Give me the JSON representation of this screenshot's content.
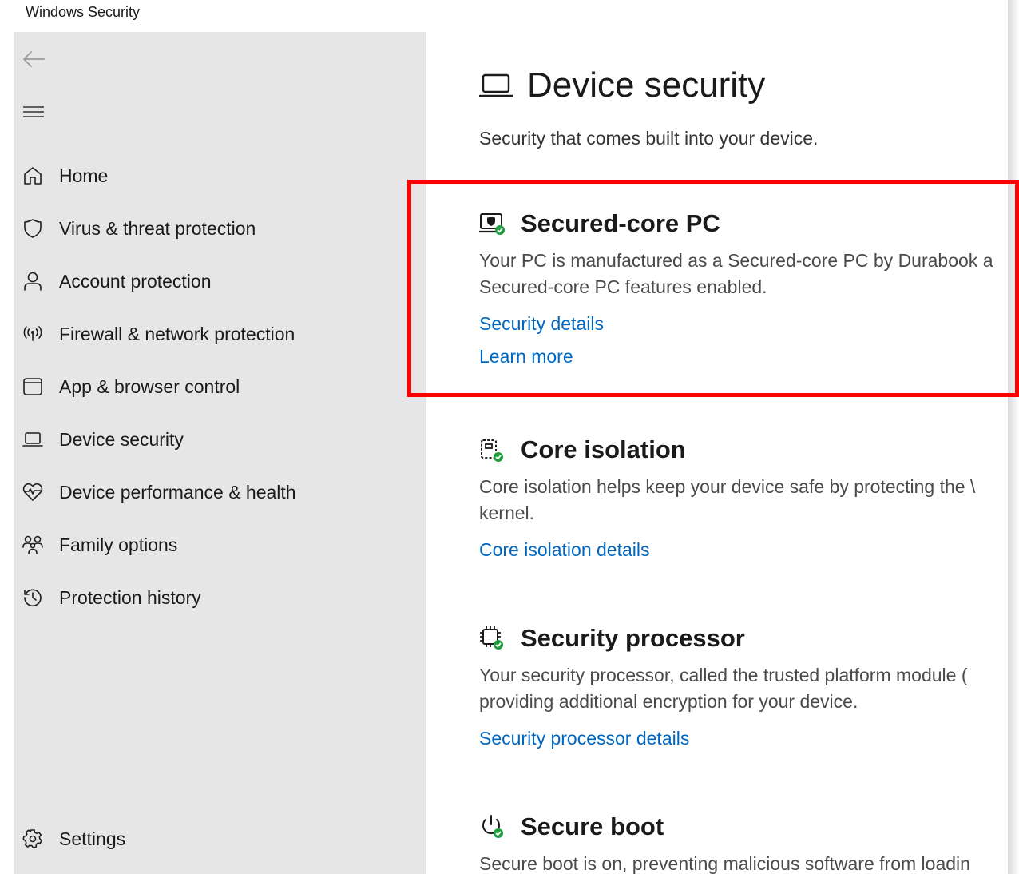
{
  "window": {
    "title": "Windows Security"
  },
  "sidebar": {
    "items": [
      {
        "label": "Home",
        "icon": "home-icon"
      },
      {
        "label": "Virus & threat protection",
        "icon": "shield-icon"
      },
      {
        "label": "Account protection",
        "icon": "person-icon"
      },
      {
        "label": "Firewall & network protection",
        "icon": "wireless-icon"
      },
      {
        "label": "App & browser control",
        "icon": "browser-icon"
      },
      {
        "label": "Device security",
        "icon": "laptop-icon"
      },
      {
        "label": "Device performance & health",
        "icon": "heart-icon"
      },
      {
        "label": "Family options",
        "icon": "family-icon"
      },
      {
        "label": "Protection history",
        "icon": "history-icon"
      }
    ],
    "settings_label": "Settings"
  },
  "main": {
    "title": "Device security",
    "subtitle": "Security that comes built into your device.",
    "sections": [
      {
        "title": "Secured-core PC",
        "desc_line1": "Your PC is manufactured as a Secured-core PC by Durabook a",
        "desc_line2": "Secured-core PC features enabled.",
        "links": [
          "Security details",
          "Learn more"
        ]
      },
      {
        "title": "Core isolation",
        "desc_line1": "Core isolation helps keep your device safe by protecting the \\",
        "desc_line2": "kernel.",
        "links": [
          "Core isolation details"
        ]
      },
      {
        "title": "Security processor",
        "desc_line1": "Your security processor, called the trusted platform module (",
        "desc_line2": "providing additional encryption for your device.",
        "links": [
          "Security processor details"
        ]
      },
      {
        "title": "Secure boot",
        "desc_line1": "Secure boot is on, preventing malicious software from loadin"
      }
    ]
  },
  "colors": {
    "link": "#0067c0",
    "sidebar_bg": "#e6e6e6",
    "highlight": "#ff0000",
    "status_ok": "#1e9e3e"
  }
}
